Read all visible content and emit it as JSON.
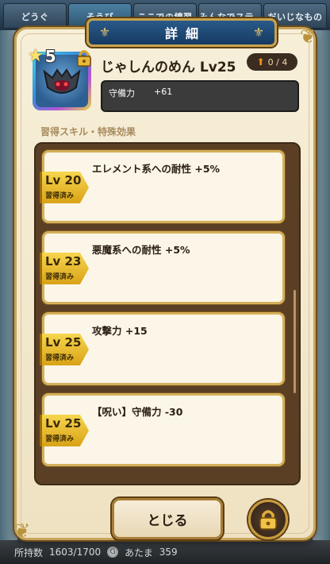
{
  "background_tabs": [
    "どうぐ",
    "そうび",
    "ここでの練習",
    "みんなでステンプ",
    "だいじなもの"
  ],
  "footer": {
    "possession_label": "所持数",
    "possession_value": "1603/1700",
    "coin_symbol": "G",
    "money_label": "あたま",
    "money_value": "359"
  },
  "dialog": {
    "title": "詳細",
    "item": {
      "star_rank": "5",
      "name": "じゃしんのめん Lv25",
      "upgrade": "0 / 4",
      "stat_label": "守備力",
      "stat_value": "+61"
    },
    "section_title": "習得スキル・特殊効果",
    "skills": [
      {
        "level": "Lv 20",
        "status": "習得済み",
        "text": "エレメント系への耐性 +5%"
      },
      {
        "level": "Lv 23",
        "status": "習得済み",
        "text": "悪魔系への耐性 +5%"
      },
      {
        "level": "Lv 25",
        "status": "習得済み",
        "text": "攻撃力 +15"
      },
      {
        "level": "Lv 25",
        "status": "習得済み",
        "text": "【呪い】守備力 -30"
      }
    ],
    "close_label": "とじる"
  },
  "colors": {
    "frame_gold": "#c8a55a",
    "title_blue": "#153a62",
    "panel_brown": "#5a3f24",
    "tag_yellow": "#f7d64e"
  },
  "icons": [
    "fleur-icon",
    "star-icon",
    "lock-icon",
    "arrow-up-icon",
    "helmet-icon"
  ]
}
